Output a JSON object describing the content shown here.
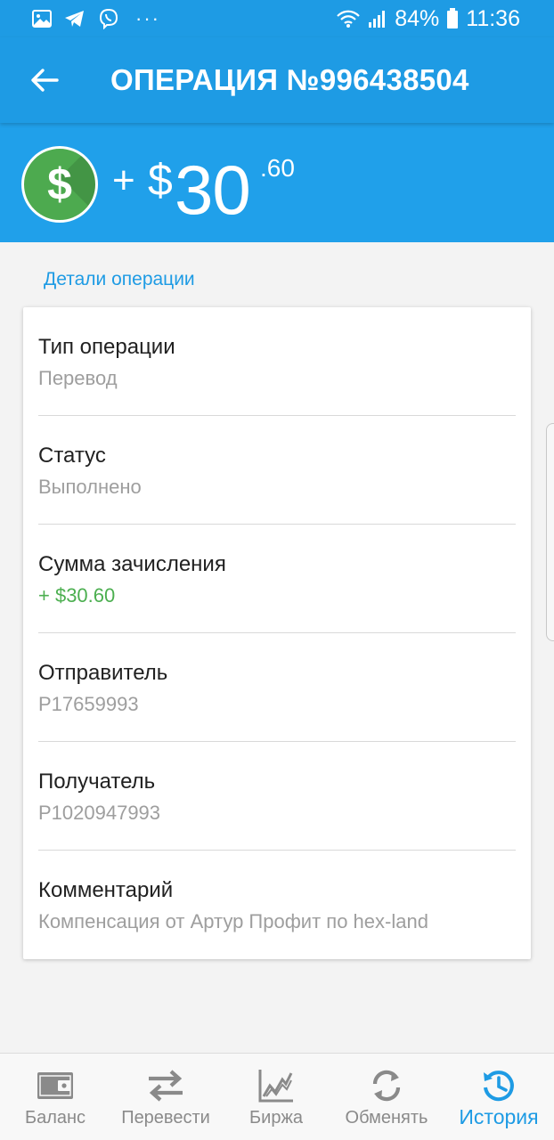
{
  "status_bar": {
    "battery": "84%",
    "time": "11:36",
    "left_icons": [
      "gallery-icon",
      "telegram-icon",
      "viber-icon",
      "more-dots-icon"
    ],
    "right_icons": [
      "wifi-icon",
      "signal-icon",
      "battery-icon"
    ]
  },
  "app_bar": {
    "title": "ОПЕРАЦИЯ №996438504",
    "back_icon": "arrow-left-icon"
  },
  "amount": {
    "sign": "+",
    "currency": "$",
    "integer": "30",
    "decimal": ".60",
    "icon": "dollar-coin-icon"
  },
  "section_label": "Детали операции",
  "details": [
    {
      "label": "Тип операции",
      "value": "Перевод",
      "highlight": false
    },
    {
      "label": "Статус",
      "value": "Выполнено",
      "highlight": false
    },
    {
      "label": "Сумма зачисления",
      "value": "+ $30.60",
      "highlight": true
    },
    {
      "label": "Отправитель",
      "value": "P17659993",
      "highlight": false
    },
    {
      "label": "Получатель",
      "value": "P1020947993",
      "highlight": false
    },
    {
      "label": "Комментарий",
      "value": "Компенсация от Артур Профит по hex-land",
      "highlight": false
    }
  ],
  "bottom_nav": [
    {
      "label": "Баланс",
      "icon": "wallet-icon",
      "active": false
    },
    {
      "label": "Перевести",
      "icon": "transfer-arrows-icon",
      "active": false
    },
    {
      "label": "Биржа",
      "icon": "chart-icon",
      "active": false
    },
    {
      "label": "Обменять",
      "icon": "exchange-refresh-icon",
      "active": false
    },
    {
      "label": "История",
      "icon": "history-icon",
      "active": true
    }
  ],
  "colors": {
    "primary": "#1e9be4",
    "header": "#20a0ea",
    "success": "#4caf50",
    "coin": "#4daa4f"
  }
}
